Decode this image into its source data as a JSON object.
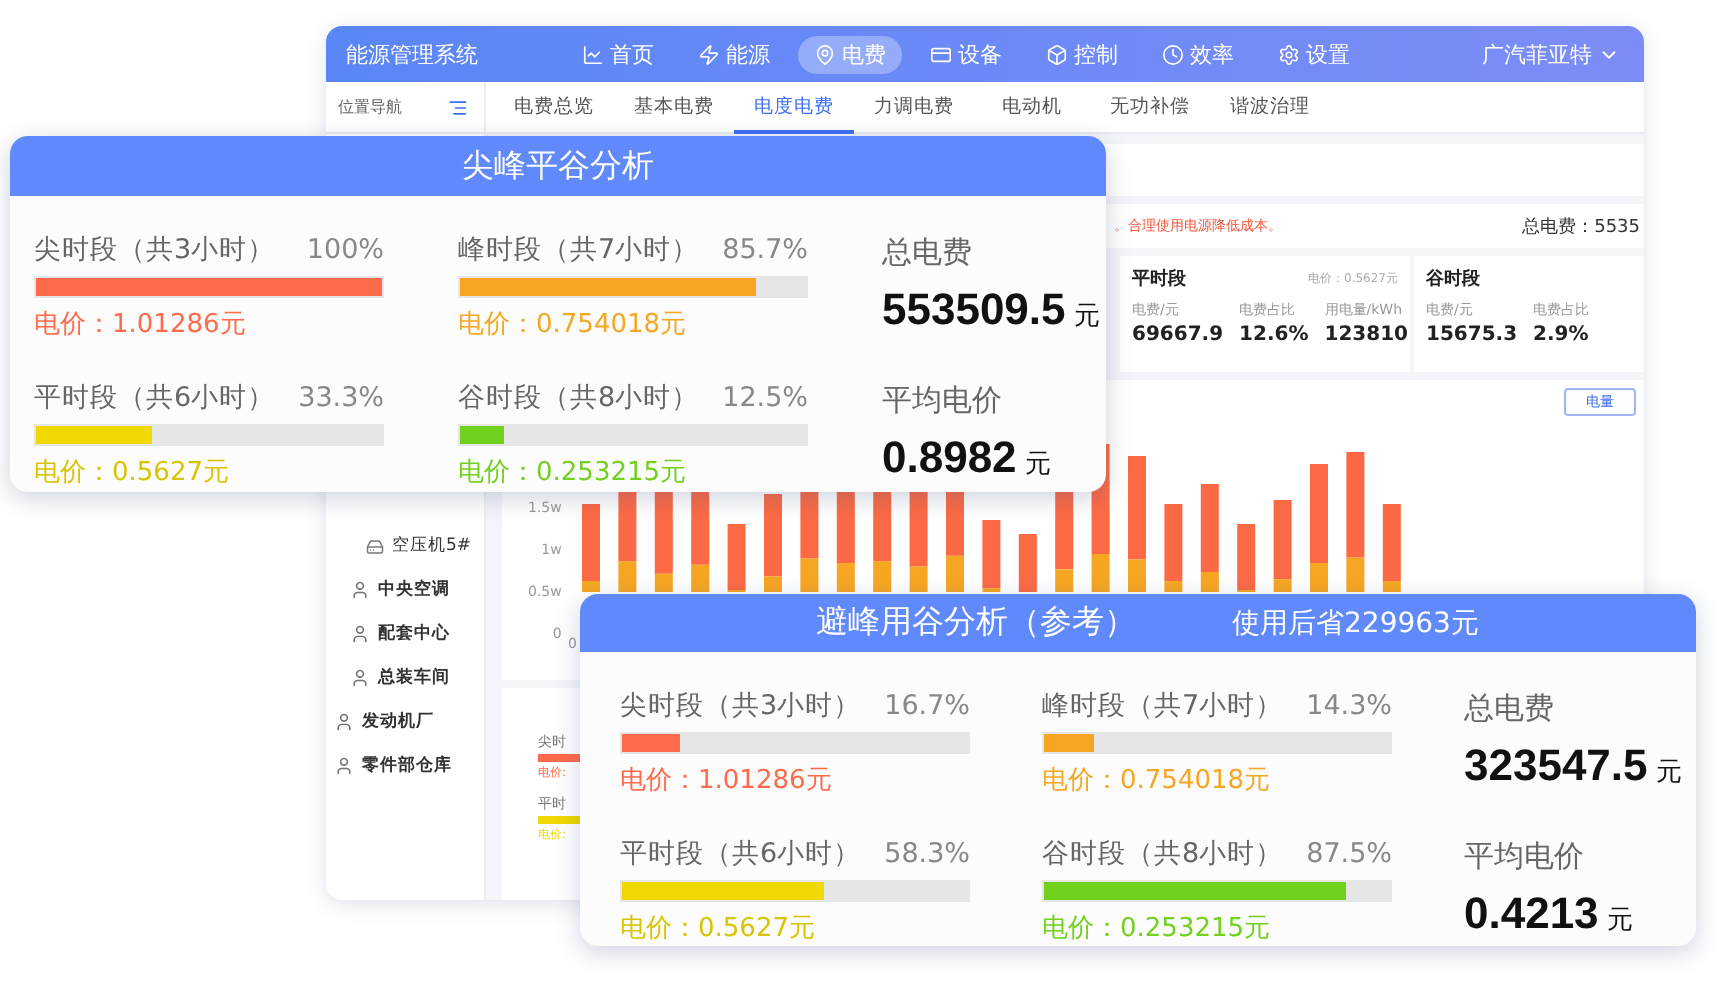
{
  "app": {
    "title": "能源管理系统",
    "nav": [
      {
        "label": "首页",
        "selected": false
      },
      {
        "label": "能源",
        "selected": false
      },
      {
        "label": "电费",
        "selected": true
      },
      {
        "label": "设备",
        "selected": false
      },
      {
        "label": "控制",
        "selected": false
      },
      {
        "label": "效率",
        "selected": false
      },
      {
        "label": "设置",
        "selected": false
      }
    ],
    "company": "广汽菲亚特",
    "sidebar": {
      "title": "位置导航",
      "tree": [
        {
          "children": [
            {
              "children": [
                {
                  "label": "空压机5#"
                }
              ]
            },
            {
              "label": "中央空调"
            },
            {
              "label": "配套中心"
            },
            {
              "label": "总装车间"
            }
          ]
        },
        {
          "label": "发动机厂"
        },
        {
          "label": "零件部仓库"
        }
      ]
    },
    "tabs": [
      {
        "label": "电费总览",
        "selected": false
      },
      {
        "label": "基本电费",
        "selected": false
      },
      {
        "label": "电度电费",
        "selected": true
      },
      {
        "label": "力调电费",
        "selected": false
      },
      {
        "label": "电动机",
        "selected": false
      },
      {
        "label": "无功补偿",
        "selected": false
      },
      {
        "label": "谐波治理",
        "selected": false
      }
    ],
    "notice": "。合理使用电源降低成本。",
    "total": "总电费：5535",
    "stats": [
      {
        "title": "平时段",
        "price": "电价：0.5627元",
        "fields": [
          {
            "label": "电费/元",
            "value": "69667.9"
          },
          {
            "label": "电费占比",
            "value": "12.6%"
          },
          {
            "label": "用电量/kWh",
            "value": "123810"
          }
        ]
      },
      {
        "title": "谷时段",
        "fields": [
          {
            "label": "电费/元",
            "value": "15675.3"
          },
          {
            "label": "电费占比",
            "value": "2.9%"
          }
        ]
      }
    ],
    "chart": {
      "toggle": "电量",
      "y_labels": [
        "1.5w",
        "1w",
        "0.5w",
        "0"
      ],
      "x_label": "0"
    },
    "legend": [
      {
        "label": "尖时",
        "price": "电价:",
        "color": "#ff6a4a"
      },
      {
        "label": "平时",
        "price": "电价:",
        "color": "#f0d800"
      }
    ]
  },
  "analyses": [
    {
      "title": "尖峰平谷分析",
      "segments": [
        {
          "label": "尖时段（共3小时）",
          "percent": "100%",
          "level": 1,
          "price": "电价：1.01286元",
          "color": "#ff6a4a"
        },
        {
          "label": "峰时段（共7小时）",
          "percent": "85.7%",
          "level": 0.857,
          "price": "电价：0.754018元",
          "color": "#f5a623"
        },
        {
          "label": "平时段（共6小时）",
          "percent": "33.3%",
          "level": 0.333,
          "price": "电价：0.5627元",
          "color": "#f0d800"
        },
        {
          "label": "谷时段（共8小时）",
          "percent": "12.5%",
          "level": 0.125,
          "price": "电价：0.253215元",
          "color": "#72d11f"
        }
      ],
      "total_label": "总电费",
      "total": "553509.5",
      "total_unit": "元",
      "avg_label": "平均电价",
      "avg": "0.8982",
      "avg_unit": "元"
    },
    {
      "title": "避峰用谷分析（参考）",
      "note": "使用后省229963元",
      "segments": [
        {
          "label": "尖时段（共3小时）",
          "percent": "16.7%",
          "level": 0.167,
          "price": "电价：1.01286元",
          "color": "#ff6a4a"
        },
        {
          "label": "峰时段（共7小时）",
          "percent": "14.3%",
          "level": 0.143,
          "price": "电价：0.754018元",
          "color": "#f5a623"
        },
        {
          "label": "平时段（共6小时）",
          "percent": "58.3%",
          "level": 0.583,
          "price": "电价：0.5627元",
          "color": "#f0d800"
        },
        {
          "label": "谷时段（共8小时）",
          "percent": "87.5%",
          "level": 0.875,
          "price": "电价：0.253215元",
          "color": "#72d11f"
        }
      ],
      "total_label": "总电费",
      "total": "323547.5",
      "total_unit": "元",
      "avg_label": "平均电价",
      "avg": "0.4213",
      "avg_unit": "元"
    }
  ]
}
